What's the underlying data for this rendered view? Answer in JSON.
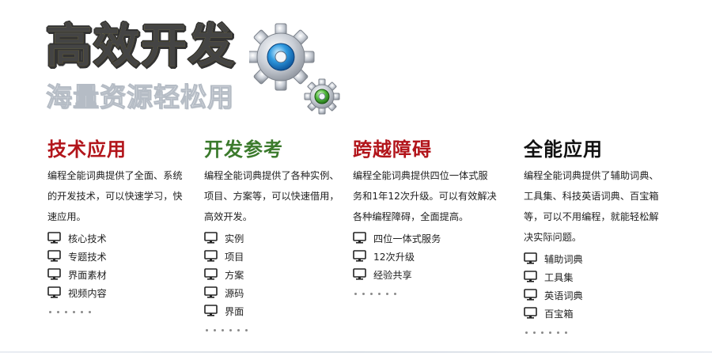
{
  "banner": {
    "title": "高效开发",
    "subtitle": "海量资源轻松用"
  },
  "columns": [
    {
      "title": "技术应用",
      "color": "#b2151b",
      "desc": "编程全能词典提供了全面、系统的开发技术，可以快速学习，快速应用。",
      "items": [
        "核心技术",
        "专题技术",
        "界面素材",
        "视频内容"
      ]
    },
    {
      "title": "开发参考",
      "color": "#3b7a2c",
      "desc": "编程全能词典提供了各种实例、项目、方案等，可以快速借用，高效开发。",
      "items": [
        "实例",
        "项目",
        "方案",
        "源码",
        "界面"
      ]
    },
    {
      "title": "跨越障碍",
      "color": "#b2151b",
      "desc": "编程全能词典提供四位一体式服务和1年12次升级。可以有效解决各种编程障碍，全面提高。",
      "items": [
        "四位一体式服务",
        "12次升级",
        "经验共享"
      ]
    },
    {
      "title": "全能应用",
      "color": "#111111",
      "desc": "编程全能词典提供了辅助词典、工具集、科技英语词典、百宝箱等，可以不用编程，就能轻松解决实际问题。",
      "items": [
        "辅助词典",
        "工具集",
        "英语词典",
        "百宝箱"
      ]
    }
  ],
  "icons": {
    "list_item": "monitor-icon",
    "logo": "gears-icon"
  }
}
